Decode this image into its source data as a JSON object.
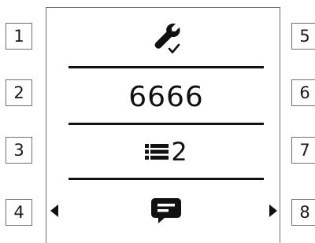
{
  "softkeys": {
    "left": [
      "1",
      "2",
      "3",
      "4"
    ],
    "right": [
      "5",
      "6",
      "7",
      "8"
    ]
  },
  "screen": {
    "line1": {
      "icon": "wrench-check-icon"
    },
    "line2": {
      "value": "6666"
    },
    "line3": {
      "icon": "list-icon",
      "count": "2"
    },
    "line4": {
      "icon": "message-icon"
    },
    "nav": {
      "left": "triangle-left-icon",
      "right": "triangle-right-icon"
    }
  },
  "colors": {
    "lcd_foreground": "#111111",
    "key_border": "#6f6f6f",
    "background": "#ffffff"
  }
}
